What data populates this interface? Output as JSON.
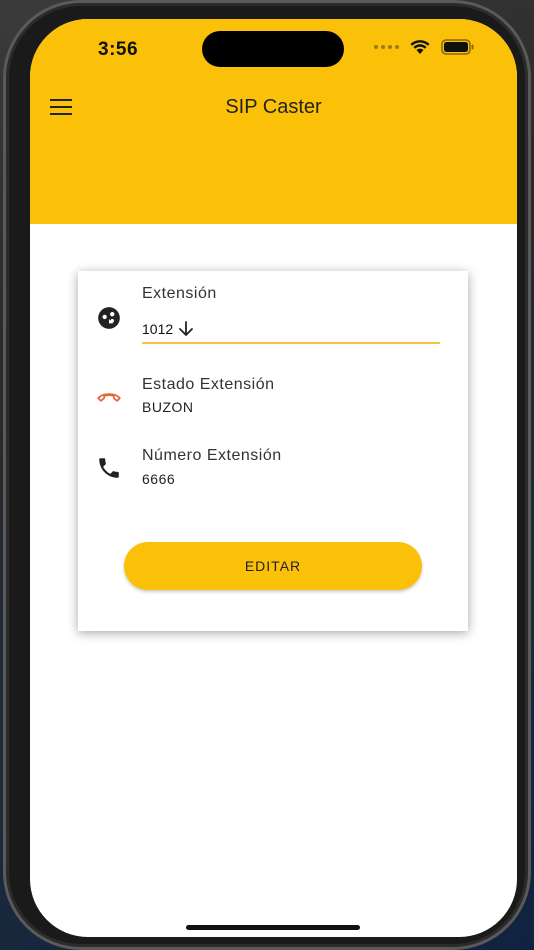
{
  "status_bar": {
    "time": "3:56"
  },
  "app_bar": {
    "title": "SIP Caster",
    "menu_icon": "hamburger-menu-icon",
    "background_color": "#FBC108"
  },
  "card": {
    "extension": {
      "label": "Extensión",
      "value": "1012",
      "icon": "extension-icon"
    },
    "status": {
      "label": "Estado Extensión",
      "value": "BUZON",
      "icon": "hangup-phone-icon",
      "icon_color": "#E8643A"
    },
    "number": {
      "label": "Número Extensión",
      "value": "6666",
      "icon": "phone-icon"
    },
    "edit_button_label": "EDITAR"
  },
  "colors": {
    "accent": "#FBC108",
    "underline": "#F5C542"
  }
}
